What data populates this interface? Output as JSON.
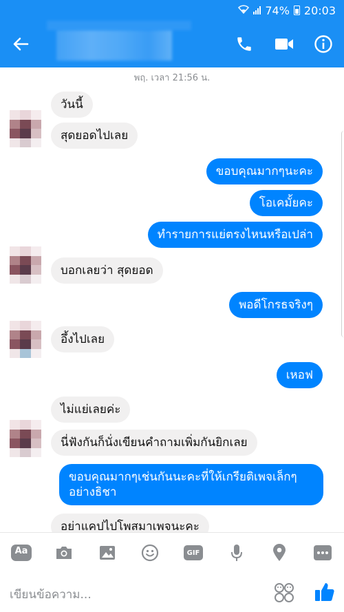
{
  "status": {
    "battery": "74%",
    "time": "20:03"
  },
  "header": {
    "contact_name": ""
  },
  "chat": {
    "timestamp": "พฤ. เวลา 21:56 น.",
    "messages": [
      {
        "dir": "in",
        "text": "วันนี้"
      },
      {
        "dir": "in",
        "text": "สุดยอดไปเลย"
      },
      {
        "dir": "out",
        "text": "ขอบคุณมากๆนะคะ"
      },
      {
        "dir": "out",
        "text": "โอเคมั้ยคะ"
      },
      {
        "dir": "out",
        "text": "ทำรายการแย่ตรงไหนหรือเปล่า"
      },
      {
        "dir": "in",
        "text": "บอกเลยว่า สุดยอด"
      },
      {
        "dir": "out",
        "text": "พอดีโกรธจริงๆ"
      },
      {
        "dir": "in",
        "text": "อึ้งไปเลย"
      },
      {
        "dir": "out",
        "text": "เหอฟ"
      },
      {
        "dir": "in",
        "text": "ไม่แย่เลยค่ะ"
      },
      {
        "dir": "in",
        "text": "นี่ฟังกันก็นั่งเขียนคำถามเพิ่มกันยิกเลย"
      },
      {
        "dir": "out",
        "text": "ขอบคุณมากๆเช่นกันนะคะที่ให้เกรียติเพจเล็กๆ อย่างธิชา"
      },
      {
        "dir": "in",
        "text": "อย่าแคปไปโพสมาเพจนะคะ"
      }
    ]
  },
  "composer": {
    "placeholder": "เขียนข้อความ...",
    "tools": [
      "text-format-icon",
      "camera-icon",
      "gallery-icon",
      "emoji-icon",
      "gif-icon",
      "microphone-icon",
      "location-icon",
      "more-icon"
    ],
    "aa_label": "Aa",
    "gif_label": "GIF"
  },
  "colors": {
    "brand": "#1a8ff5",
    "outgoing": "#0084ff",
    "incoming": "#f1f0f0",
    "toolbar_icon": "#8a8d91"
  }
}
